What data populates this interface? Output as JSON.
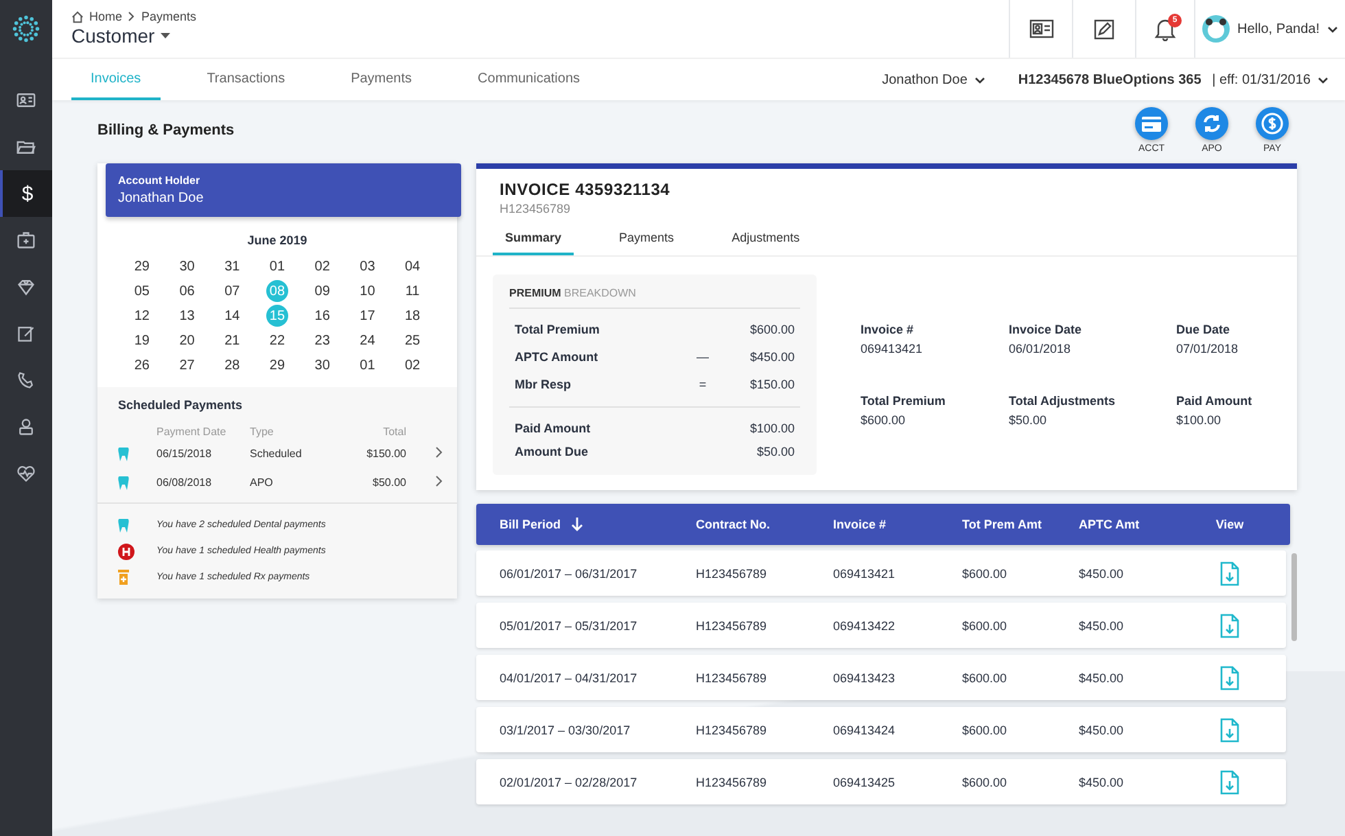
{
  "sidebar": {
    "items": [
      {
        "selected": false
      },
      {
        "selected": false
      },
      {
        "selected": true,
        "glyph": "$"
      },
      {
        "selected": false
      },
      {
        "selected": false
      },
      {
        "selected": false
      },
      {
        "selected": false
      },
      {
        "selected": false
      },
      {
        "selected": false
      }
    ]
  },
  "breadcrumb": [
    "Home",
    "Payments"
  ],
  "page_title": "Customer",
  "header_actions": {
    "notification_count": "5",
    "greeting": "Hello, Panda!"
  },
  "tabs": [
    {
      "label": "Invoices",
      "selected": true
    },
    {
      "label": "Transactions",
      "selected": false
    },
    {
      "label": "Payments",
      "selected": false
    },
    {
      "label": "Communications",
      "selected": false
    }
  ],
  "member": {
    "name": "Jonathon Doe",
    "plan": "H12345678  BlueOptions 365",
    "effective": "| eff: 01/31/2016"
  },
  "section_title": "Billing & Payments",
  "quick_actions": [
    {
      "kind": "card",
      "label": "ACCT"
    },
    {
      "kind": "sync",
      "label": "APO"
    },
    {
      "kind": "dollar",
      "label": "PAY"
    }
  ],
  "account_holder": {
    "label": "Account Holder",
    "name": "Jonathan Doe"
  },
  "calendar": {
    "month": "June 2019",
    "days": [
      {
        "day": "29",
        "selected": false
      },
      {
        "day": "30",
        "selected": false
      },
      {
        "day": "31",
        "selected": false
      },
      {
        "day": "01",
        "selected": false
      },
      {
        "day": "02",
        "selected": false
      },
      {
        "day": "03",
        "selected": false
      },
      {
        "day": "04",
        "selected": false
      },
      {
        "day": "05",
        "selected": false
      },
      {
        "day": "06",
        "selected": false
      },
      {
        "day": "07",
        "selected": false
      },
      {
        "day": "08",
        "selected": true
      },
      {
        "day": "09",
        "selected": false
      },
      {
        "day": "10",
        "selected": false
      },
      {
        "day": "11",
        "selected": false
      },
      {
        "day": "12",
        "selected": false
      },
      {
        "day": "13",
        "selected": false
      },
      {
        "day": "14",
        "selected": false
      },
      {
        "day": "15",
        "selected": true
      },
      {
        "day": "16",
        "selected": false
      },
      {
        "day": "17",
        "selected": false
      },
      {
        "day": "18",
        "selected": false
      },
      {
        "day": "19",
        "selected": false
      },
      {
        "day": "20",
        "selected": false
      },
      {
        "day": "21",
        "selected": false
      },
      {
        "day": "22",
        "selected": false
      },
      {
        "day": "23",
        "selected": false
      },
      {
        "day": "24",
        "selected": false
      },
      {
        "day": "25",
        "selected": false
      },
      {
        "day": "26",
        "selected": false
      },
      {
        "day": "27",
        "selected": false
      },
      {
        "day": "28",
        "selected": false
      },
      {
        "day": "29",
        "selected": false
      },
      {
        "day": "30",
        "selected": false
      },
      {
        "day": "01",
        "selected": false
      },
      {
        "day": "02",
        "selected": false
      }
    ]
  },
  "scheduled_payments": {
    "title": "Scheduled Payments",
    "columns": [
      "Payment Date",
      "Type",
      "Total"
    ],
    "rows": [
      {
        "kind": "dental",
        "date": "06/15/2018",
        "type": "Scheduled",
        "total": "$150.00"
      },
      {
        "kind": "dental",
        "date": "06/08/2018",
        "type": "APO",
        "total": "$50.00"
      }
    ],
    "notes": [
      {
        "kind": "dental",
        "text": "You have 2 scheduled Dental payments"
      },
      {
        "kind": "health",
        "text": "You have 1 scheduled Health payments"
      },
      {
        "kind": "rx",
        "text": "You have 1 scheduled Rx payments"
      }
    ]
  },
  "invoice": {
    "title": "INVOICE 4359321134",
    "contract": "H123456789",
    "tabs": [
      {
        "label": "Summary",
        "selected": true
      },
      {
        "label": "Payments",
        "selected": false
      },
      {
        "label": "Adjustments",
        "selected": false
      }
    ],
    "breakdown": {
      "title_bold": "PREMIUM",
      "title_rest": "BREAKDOWN",
      "lines": [
        {
          "label": "Total Premium",
          "value": "$600.00"
        },
        {
          "label": "APTC Amount",
          "operator": "—",
          "value": "$450.00"
        },
        {
          "label": "Mbr Resp",
          "operator": "=",
          "value": "$150.00"
        }
      ],
      "totals": [
        {
          "label": "Paid Amount",
          "value": "$100.00"
        },
        {
          "label": "Amount Due",
          "value": "$50.00"
        }
      ]
    },
    "details": [
      {
        "label": "Invoice #",
        "value": "069413421"
      },
      {
        "label": "Invoice Date",
        "value": "06/01/2018"
      },
      {
        "label": "Due Date",
        "value": "07/01/2018"
      },
      {
        "label": "Total Premium",
        "value": "$600.00"
      },
      {
        "label": "Total Adjustments",
        "value": "$50.00"
      },
      {
        "label": "Paid Amount",
        "value": "$100.00"
      }
    ]
  },
  "bills": {
    "columns": [
      "Bill Period",
      "Contract No.",
      "Invoice #",
      "Tot Prem Amt",
      "APTC Amt",
      "View"
    ],
    "rows": [
      [
        "06/01/2017 – 06/31/2017",
        "H123456789",
        "069413421",
        "$600.00",
        "$450.00"
      ],
      [
        "05/01/2017 – 05/31/2017",
        "H123456789",
        "069413422",
        "$600.00",
        "$450.00"
      ],
      [
        "04/01/2017 – 04/31/2017",
        "H123456789",
        "069413423",
        "$600.00",
        "$450.00"
      ],
      [
        "03/1/2017 – 03/30/2017",
        "H123456789",
        "069413424",
        "$600.00",
        "$450.00"
      ],
      [
        "02/01/2017 – 02/28/2017",
        "H123456789",
        "069413425",
        "$600.00",
        "$450.00"
      ]
    ]
  }
}
